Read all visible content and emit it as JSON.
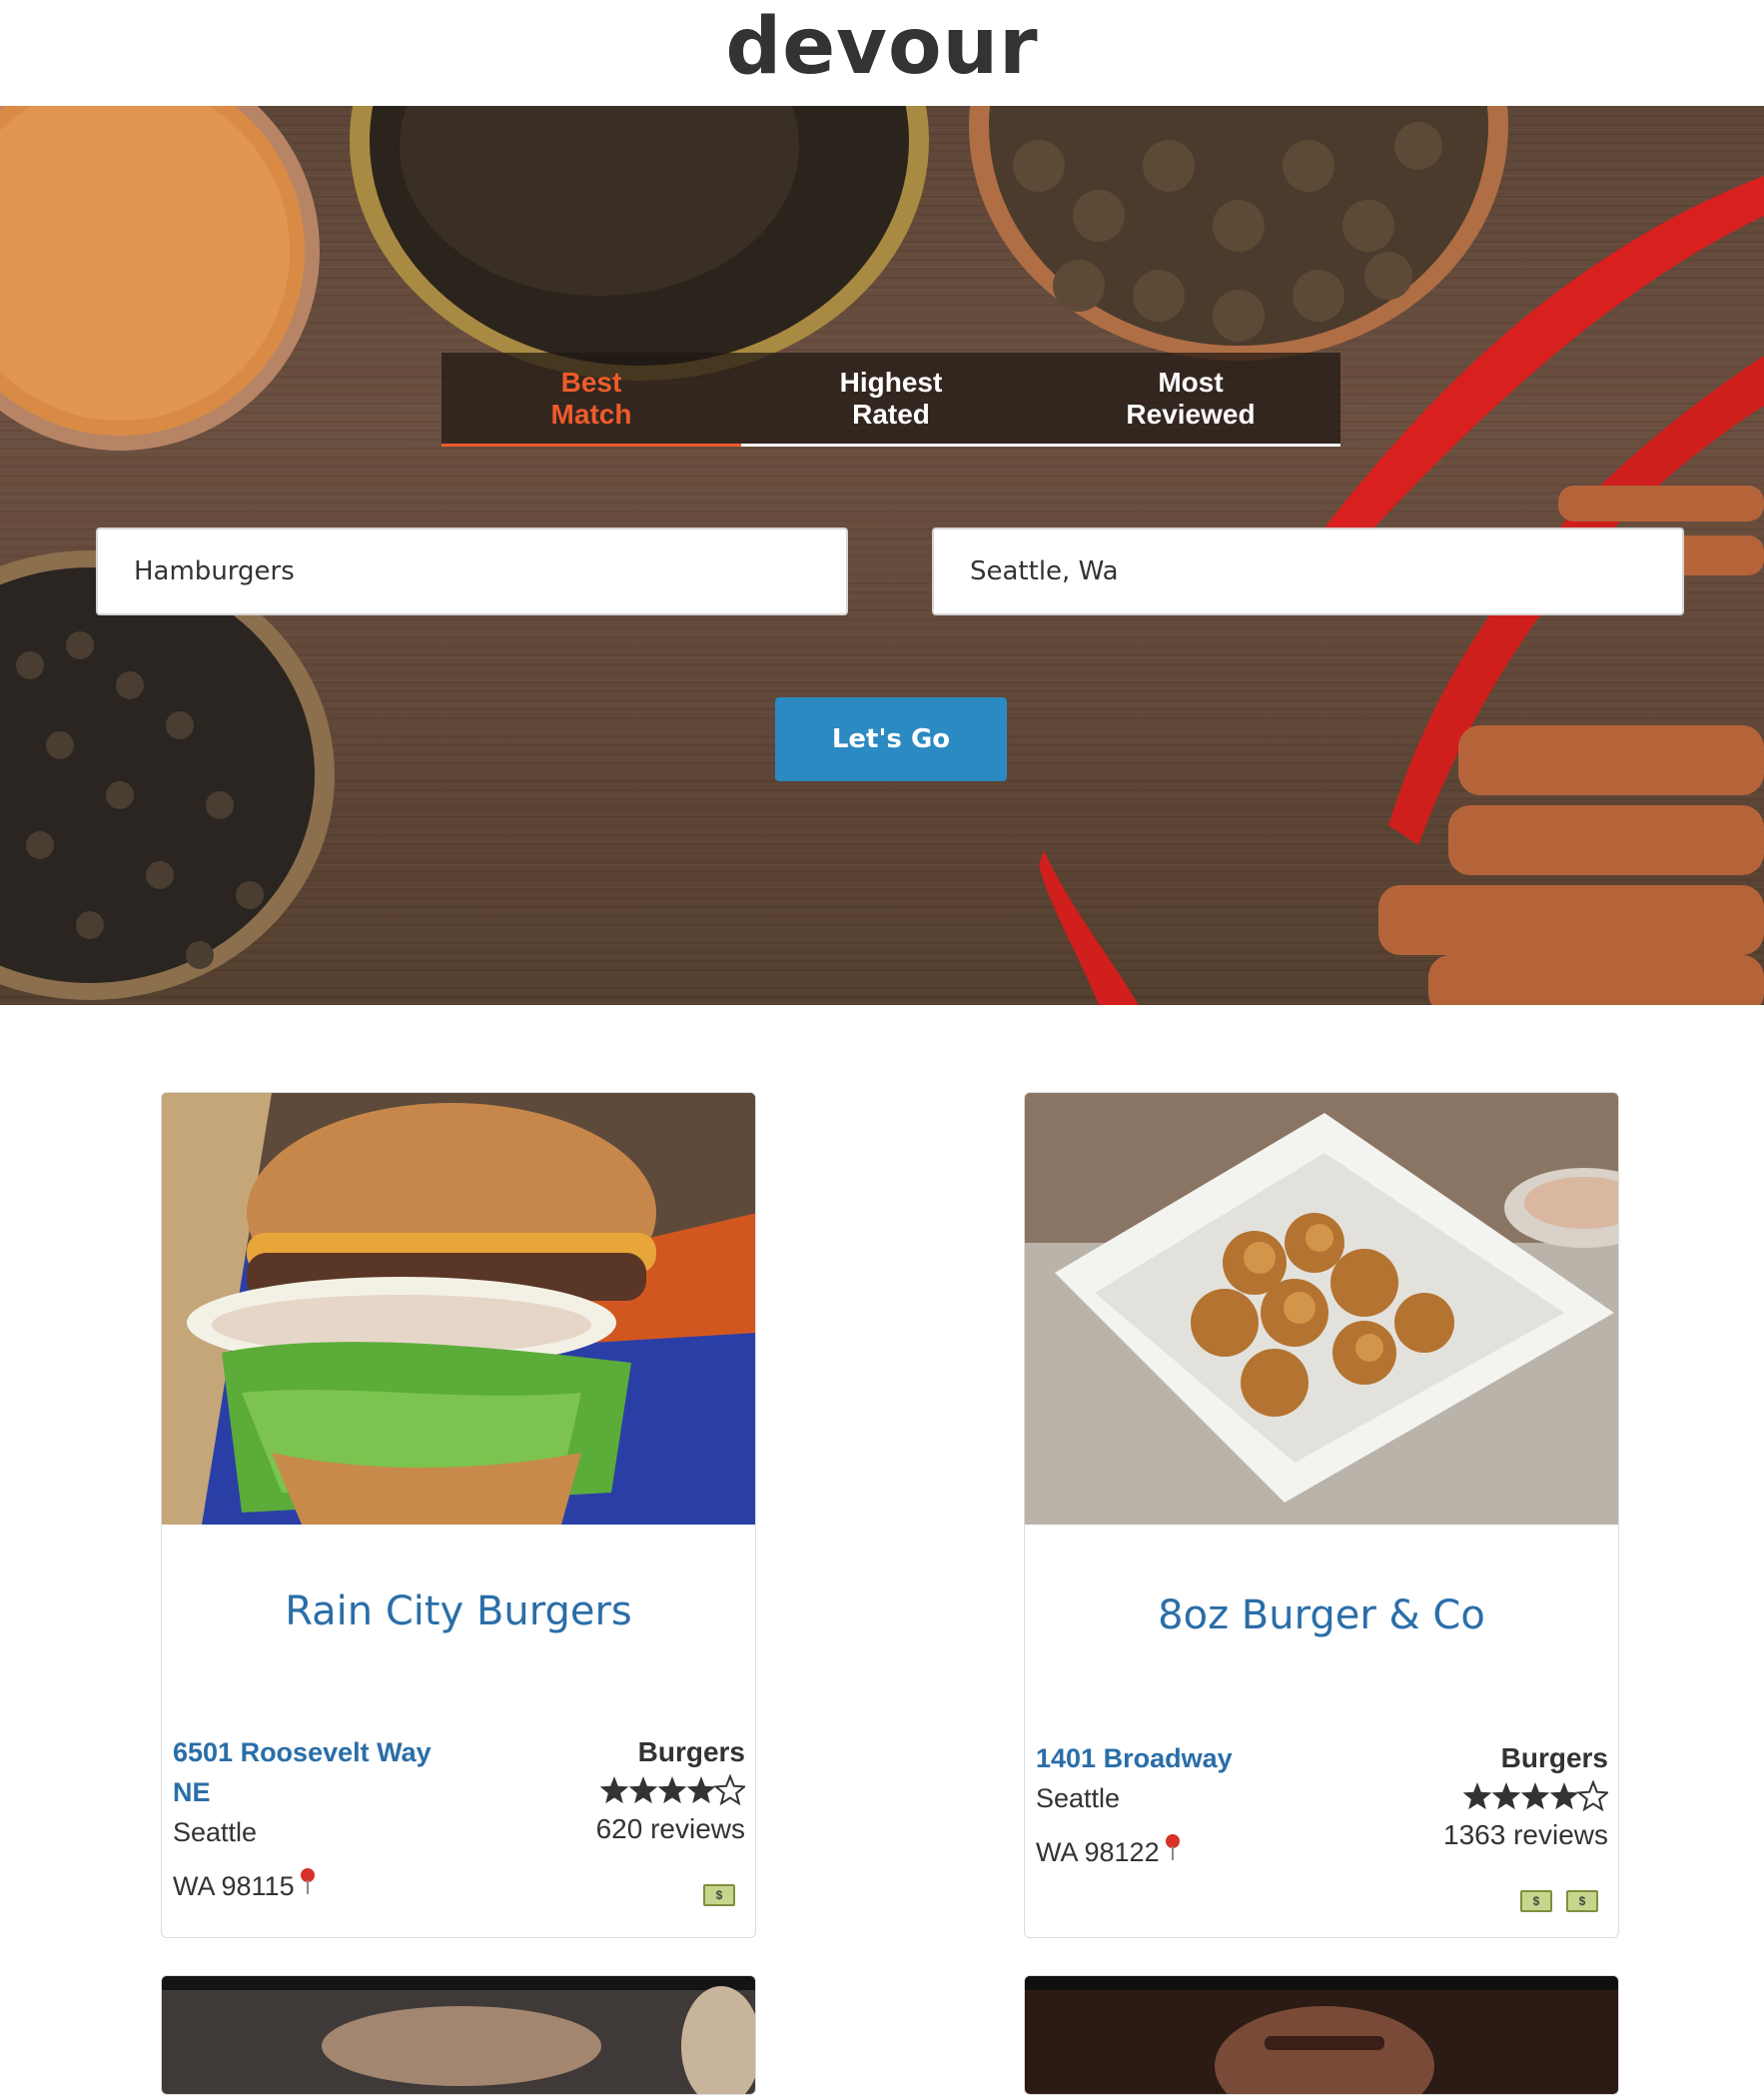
{
  "app": {
    "logo": "devour"
  },
  "sort_tabs": [
    {
      "line1": "Best",
      "line2": "Match",
      "active": true
    },
    {
      "line1": "Highest",
      "line2": "Rated",
      "active": false
    },
    {
      "line1": "Most",
      "line2": "Reviewed",
      "active": false
    }
  ],
  "search": {
    "query_value": "Hamburgers",
    "location_value": "Seattle, Wa",
    "submit_label": "Let's Go"
  },
  "colors": {
    "accent": "#ef5b2c",
    "link": "#2a6ea8",
    "button": "#2b8ac2"
  },
  "results": [
    {
      "name": "Rain City Burgers",
      "street_line1": "6501 Roosevelt Way",
      "street_line2": "NE",
      "city": "Seattle",
      "state_zip": "WA 98115",
      "category": "Burgers",
      "rating": 4,
      "rating_max": 5,
      "reviews": "620 reviews",
      "price_level": 1,
      "photo_icon": "burger-photo"
    },
    {
      "name": "8oz Burger & Co",
      "street_line1": "1401 Broadway",
      "city": "Seattle",
      "state_zip": "WA 98122",
      "category": "Burgers",
      "rating": 4,
      "rating_max": 5,
      "reviews": "1363 reviews",
      "price_level": 2,
      "photo_icon": "tots-photo"
    }
  ],
  "icons": {
    "pin": "map-pin-icon",
    "star": "star-icon",
    "price": "dollar-bill-icon"
  }
}
